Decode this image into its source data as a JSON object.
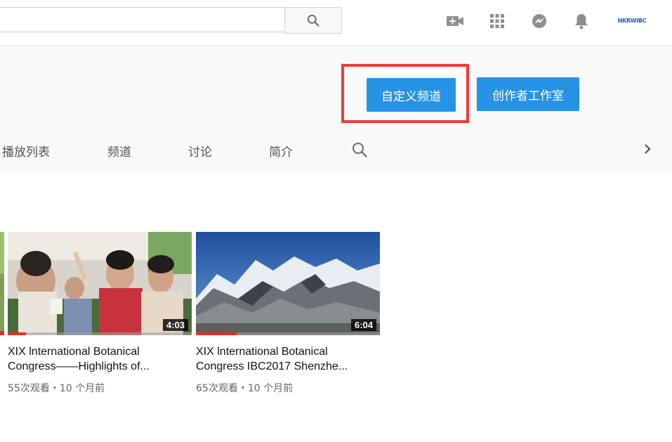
{
  "masthead": {
    "search_value": "",
    "icons": [
      "search-icon",
      "upload-video-icon",
      "apps-grid-icon",
      "messages-icon",
      "notifications-bell-icon"
    ],
    "account_logo_text": "NKRWIBC"
  },
  "channel": {
    "customize_label": "自定义频道",
    "studio_label": "创作者工作室",
    "highlight_color": "#ef3a3a",
    "button_color": "#2793e6",
    "tabs": [
      {
        "label": "播放列表"
      },
      {
        "label": "频道"
      },
      {
        "label": "讨论"
      },
      {
        "label": "简介"
      }
    ]
  },
  "videos": [
    {
      "title_line1": "XIX lnternational Botanical",
      "title_line2": "Congress——Highlights of...",
      "duration": "4:03",
      "meta": "55次观看・10 个月前",
      "watched_fraction": 0.1
    },
    {
      "title_line1": "XIX lnternational Botanical",
      "title_line2": "Congress IBC2017 Shenzhe...",
      "duration": "6:04",
      "meta": "65次观看・10 个月前",
      "watched_fraction": 0.22
    }
  ]
}
